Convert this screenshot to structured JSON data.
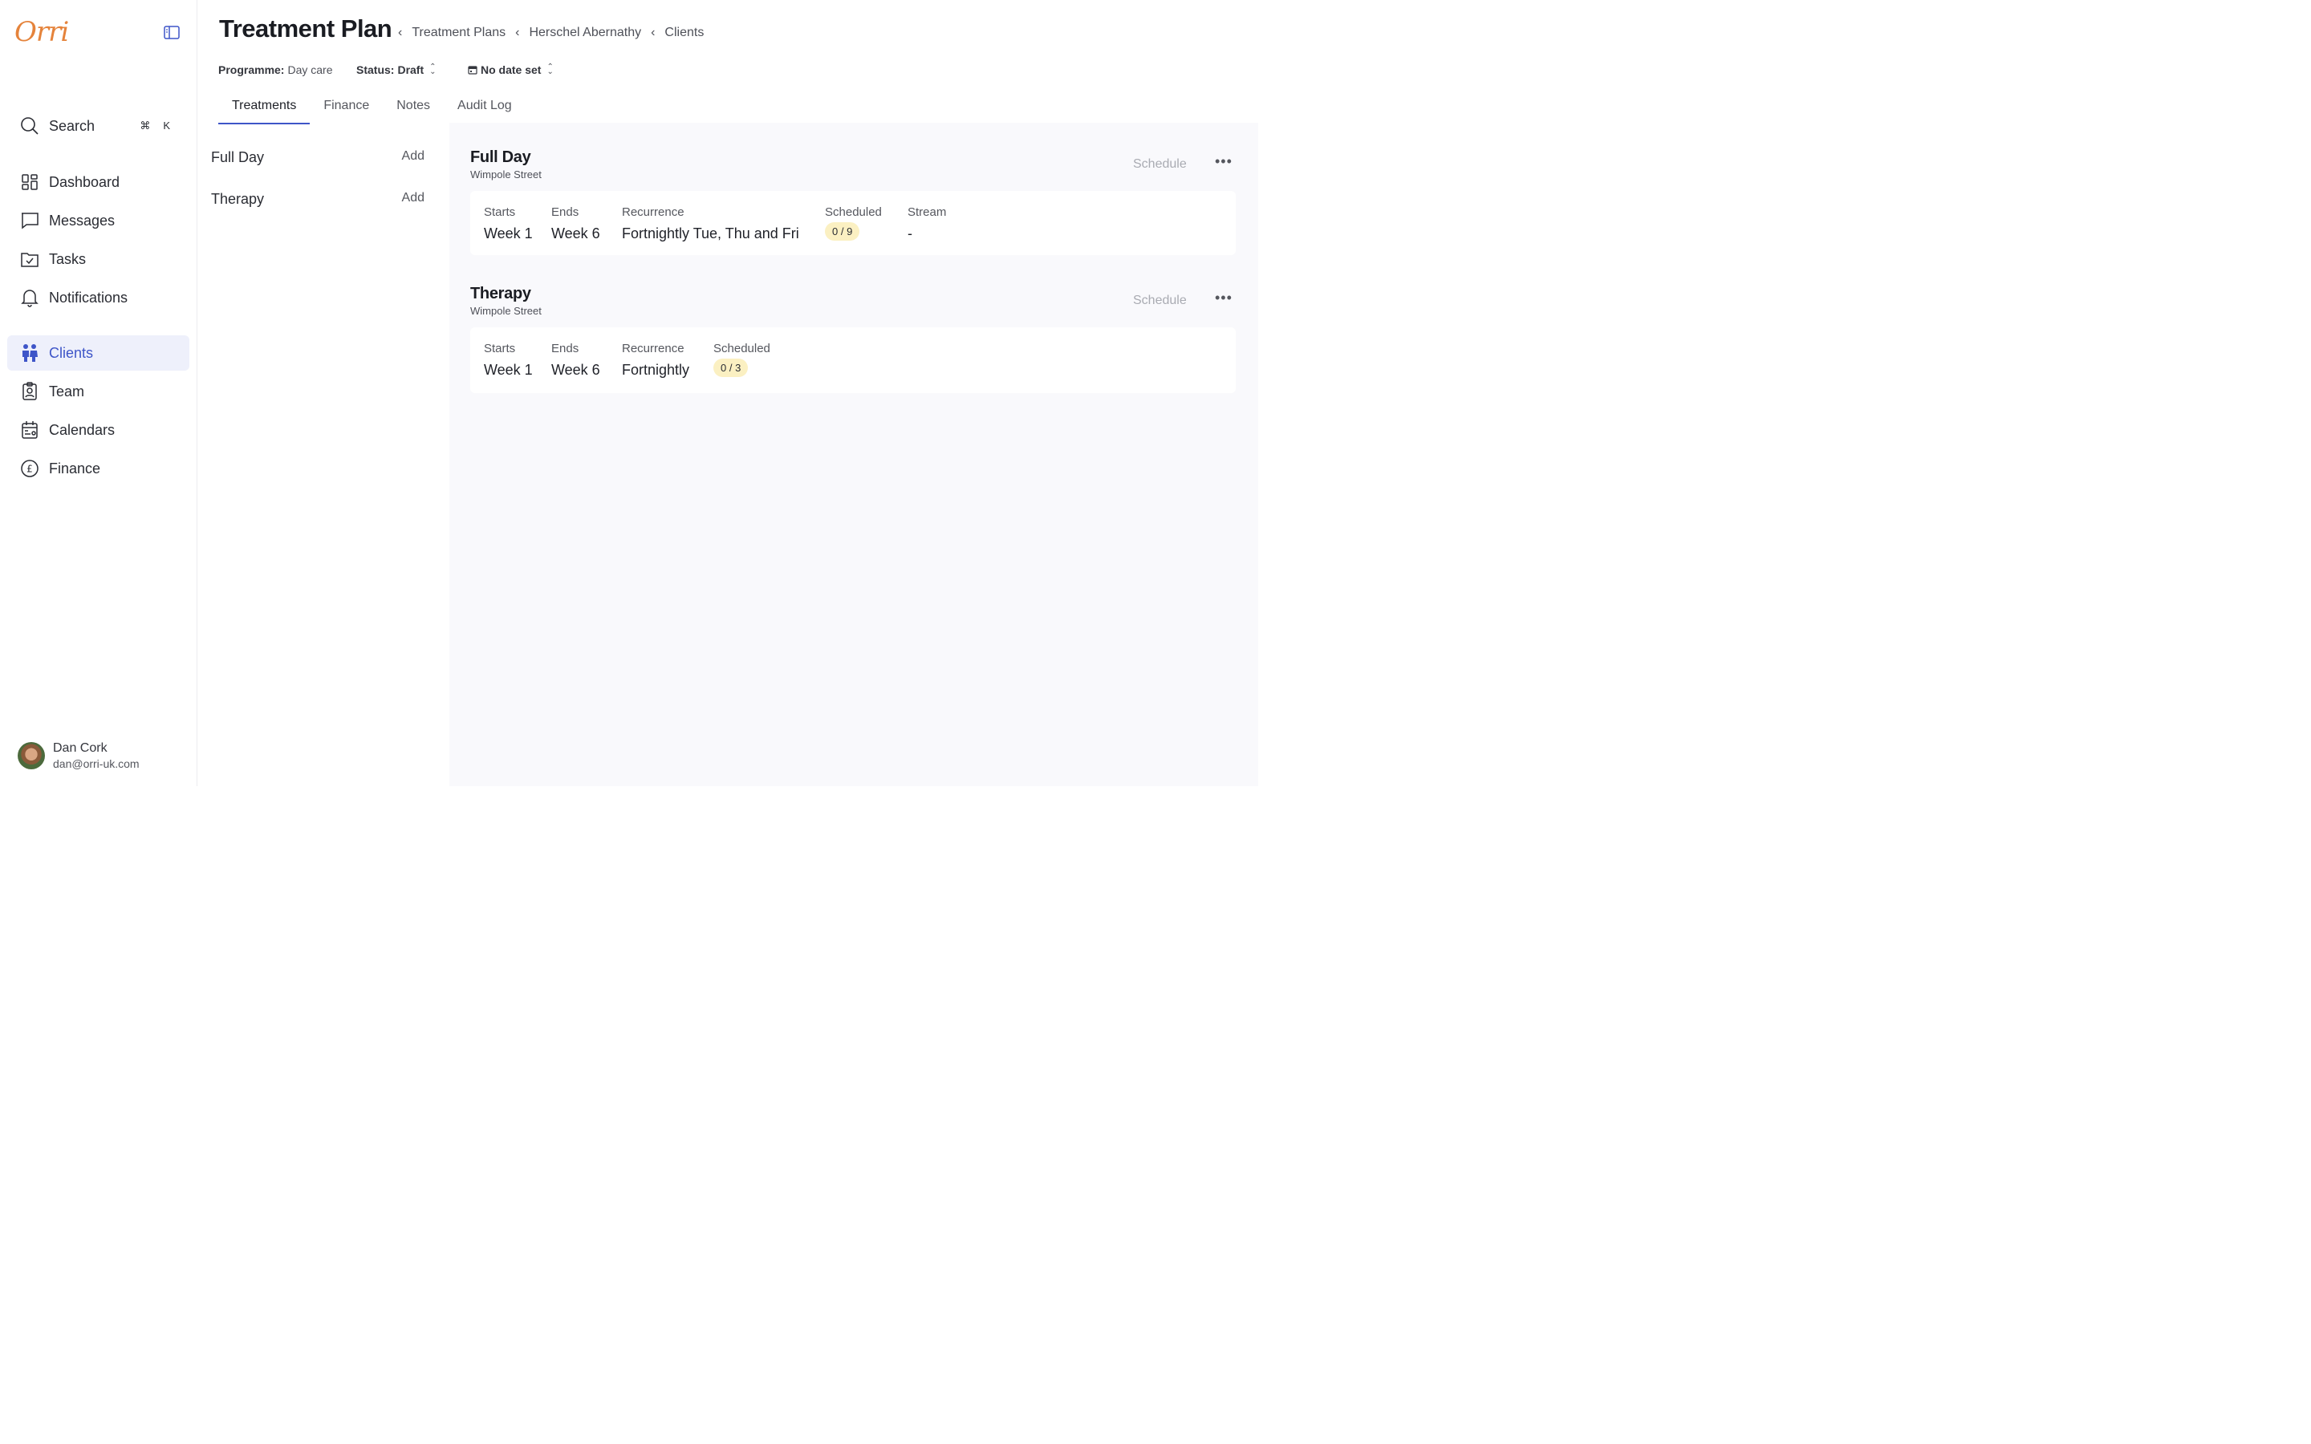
{
  "app": {
    "logo": "Orri"
  },
  "sidebar": {
    "search": {
      "label": "Search",
      "kbd_cmd": "⌘",
      "kbd_key": "K"
    },
    "items": [
      {
        "label": "Dashboard",
        "icon": "grid-icon"
      },
      {
        "label": "Messages",
        "icon": "message-icon"
      },
      {
        "label": "Tasks",
        "icon": "folder-check-icon"
      },
      {
        "label": "Notifications",
        "icon": "bell-icon"
      },
      {
        "label": "Clients",
        "icon": "people-icon",
        "active": true
      },
      {
        "label": "Team",
        "icon": "badge-icon"
      },
      {
        "label": "Calendars",
        "icon": "calendar-icon"
      },
      {
        "label": "Finance",
        "icon": "pound-icon"
      }
    ],
    "user": {
      "name": "Dan Cork",
      "email": "dan@orri-uk.com"
    }
  },
  "header": {
    "title": "Treatment Plan",
    "breadcrumb": [
      "Treatment Plans",
      "Herschel Abernathy",
      "Clients"
    ],
    "programme_label": "Programme:",
    "programme_value": "Day care",
    "status_label": "Status:",
    "status_value": "Draft",
    "date_value": "No date set"
  },
  "tabs": [
    "Treatments",
    "Finance",
    "Notes",
    "Audit Log"
  ],
  "treatment_list": [
    {
      "name": "Full Day",
      "action": "Add"
    },
    {
      "name": "Therapy",
      "action": "Add"
    }
  ],
  "blocks": [
    {
      "title": "Full Day",
      "location": "Wimpole Street",
      "schedule_label": "Schedule",
      "columns": {
        "starts_label": "Starts",
        "starts": "Week 1",
        "ends_label": "Ends",
        "ends": "Week 6",
        "recurrence_label": "Recurrence",
        "recurrence": "Fortnightly Tue, Thu and Fri",
        "scheduled_label": "Scheduled",
        "scheduled": "0 / 9",
        "stream_label": "Stream",
        "stream": "-"
      }
    },
    {
      "title": "Therapy",
      "location": "Wimpole Street",
      "schedule_label": "Schedule",
      "columns": {
        "starts_label": "Starts",
        "starts": "Week 1",
        "ends_label": "Ends",
        "ends": "Week 6",
        "recurrence_label": "Recurrence",
        "recurrence": "Fortnightly",
        "scheduled_label": "Scheduled",
        "scheduled": "0 / 3"
      }
    }
  ],
  "colors": {
    "accent": "#3e55c8",
    "brand": "#e5833b",
    "pill": "#fbf0c2"
  }
}
